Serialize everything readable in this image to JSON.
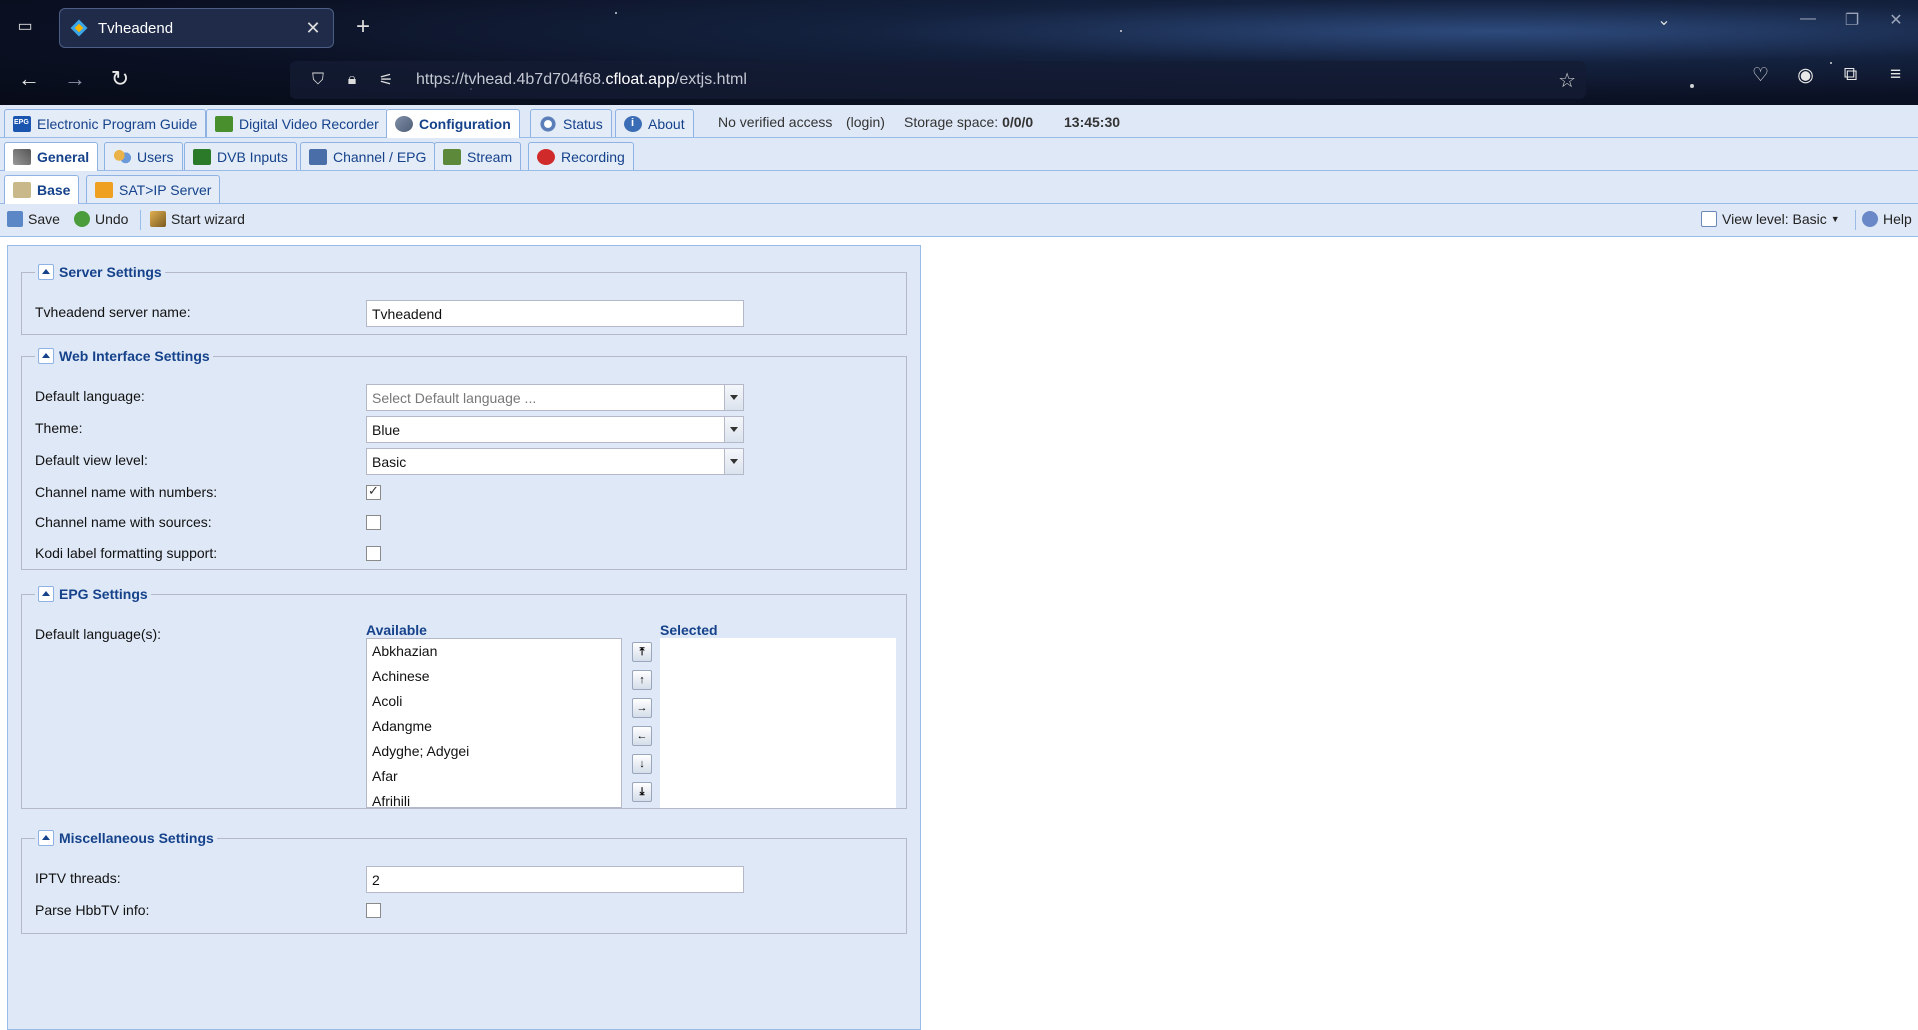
{
  "browser": {
    "tab_title": "Tvheadend",
    "url_prefix": "https://tvhead.4b7d704f68.",
    "url_domain": "cfloat.app",
    "url_suffix": "/extjs.html"
  },
  "main_tabs": [
    {
      "label": "Electronic Program Guide",
      "icon": "epg-icon"
    },
    {
      "label": "Digital Video Recorder",
      "icon": "dvr-icon"
    },
    {
      "label": "Configuration",
      "icon": "config-icon",
      "active": true
    },
    {
      "label": "Status",
      "icon": "status-icon"
    },
    {
      "label": "About",
      "icon": "about-icon"
    }
  ],
  "header_status": {
    "access": "No verified access",
    "login": "(login)",
    "storage_label": "Storage space:",
    "storage_value": "0/0/0",
    "time": "13:45:30"
  },
  "config_tabs": [
    {
      "label": "General",
      "active": true
    },
    {
      "label": "Users"
    },
    {
      "label": "DVB Inputs"
    },
    {
      "label": "Channel / EPG"
    },
    {
      "label": "Stream"
    },
    {
      "label": "Recording"
    }
  ],
  "sub_tabs": [
    {
      "label": "Base",
      "active": true
    },
    {
      "label": "SAT>IP Server"
    }
  ],
  "toolbar": {
    "save": "Save",
    "undo": "Undo",
    "wizard": "Start wizard",
    "view_level": "View level: Basic",
    "help": "Help"
  },
  "server_settings": {
    "legend": "Server Settings",
    "name_label": "Tvheadend server name:",
    "name_value": "Tvheadend"
  },
  "web_settings": {
    "legend": "Web Interface Settings",
    "lang_label": "Default language:",
    "lang_placeholder": "Select Default language ...",
    "theme_label": "Theme:",
    "theme_value": "Blue",
    "view_label": "Default view level:",
    "view_value": "Basic",
    "chan_numbers_label": "Channel name with numbers:",
    "chan_numbers_checked": true,
    "chan_sources_label": "Channel name with sources:",
    "chan_sources_checked": false,
    "kodi_label": "Kodi label formatting support:",
    "kodi_checked": false
  },
  "epg_settings": {
    "legend": "EPG Settings",
    "lang_label": "Default language(s):",
    "available_header": "Available",
    "selected_header": "Selected",
    "available": [
      "Abkhazian",
      "Achinese",
      "Acoli",
      "Adangme",
      "Adyghe; Adygei",
      "Afar",
      "Afrihili"
    ],
    "selected": []
  },
  "misc_settings": {
    "legend": "Miscellaneous Settings",
    "iptv_label": "IPTV threads:",
    "iptv_value": "2",
    "hbbtv_label": "Parse HbbTV info:",
    "hbbtv_checked": false
  }
}
